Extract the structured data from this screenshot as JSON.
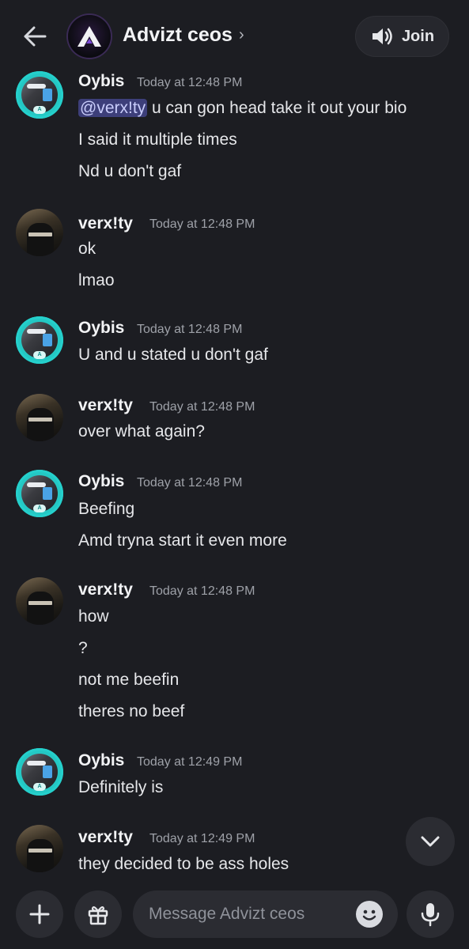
{
  "header": {
    "title": "Advizt ceos",
    "chevron": "›",
    "join_label": "Join",
    "icons": {
      "back": "arrow-left-icon",
      "voice": "speaker-icon",
      "server": "server-logo-icon"
    }
  },
  "messages": [
    {
      "author": "Oybis",
      "time": "Today at 12:48 PM",
      "mention": "@verx!ty",
      "lines": [
        "u can gon head take it out your bio",
        "I said it multiple times",
        "Nd u don't gaf"
      ]
    },
    {
      "author": "verx!ty",
      "time": "Today at 12:48 PM",
      "lines": [
        "ok",
        "lmao"
      ]
    },
    {
      "author": "Oybis",
      "time": "Today at 12:48 PM",
      "lines": [
        "U and u stated u don't gaf"
      ]
    },
    {
      "author": "verx!ty",
      "time": "Today at 12:48 PM",
      "lines": [
        "over what again?"
      ]
    },
    {
      "author": "Oybis",
      "time": "Today at 12:48 PM",
      "lines": [
        "Beefing",
        "Amd tryna start it even more"
      ]
    },
    {
      "author": "verx!ty",
      "time": "Today at 12:48 PM",
      "lines": [
        "how",
        "?",
        "not me beefin",
        "theres no beef"
      ]
    },
    {
      "author": "Oybis",
      "time": "Today at 12:49 PM",
      "lines": [
        "Definitely is"
      ]
    },
    {
      "author": "verx!ty",
      "time": "Today at 12:49 PM",
      "lines": [
        "they decided to be ass holes"
      ]
    }
  ],
  "composer": {
    "placeholder": "Message Advizt ceos",
    "icons": {
      "add": "plus-icon",
      "gift": "gift-icon",
      "emoji": "emoji-icon",
      "mic": "microphone-icon",
      "jump": "chevron-down-icon"
    }
  },
  "colors": {
    "background": "#1c1d22",
    "surface": "#2b2c32",
    "mention_bg": "#3d3f7a",
    "oybis_ring": "#25d0cc"
  }
}
